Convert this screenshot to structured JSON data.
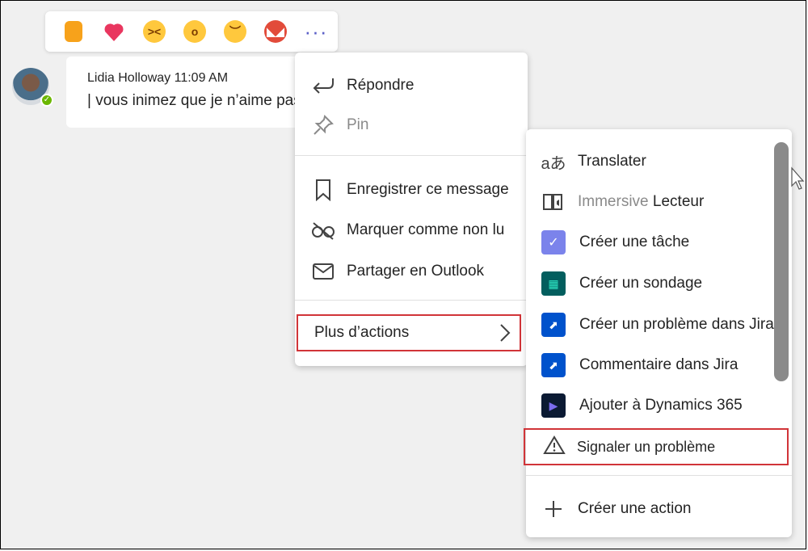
{
  "reactions": [
    {
      "name": "like",
      "color": "#f7a21b",
      "glyph": "👍"
    },
    {
      "name": "heart",
      "color": "#e9365f",
      "glyph": "❤"
    },
    {
      "name": "laugh",
      "color": "#ffc83d",
      "glyph": "😆"
    },
    {
      "name": "surprised",
      "color": "#ffc83d",
      "glyph": "😮"
    },
    {
      "name": "sad",
      "color": "#ffc83d",
      "glyph": "🙁"
    },
    {
      "name": "angry",
      "color": "#e24b3a",
      "glyph": "😡"
    }
  ],
  "message": {
    "author": "Lidia Holloway",
    "time": "11:09 AM",
    "text": "| vous inimez que je n’aime pas )"
  },
  "menu": {
    "reply": "Répondre",
    "pin": "Pin",
    "save": "Enregistrer ce message",
    "mark_unread": "Marquer comme non lu",
    "share_outlook": "Partager en Outlook",
    "more_actions": "Plus d’actions"
  },
  "submenu": {
    "translate": "Translater",
    "immersive_a": "Immersive",
    "immersive_b": "Lecteur",
    "create_task": "Créer une tâche",
    "create_poll": "Créer un sondage",
    "create_jira_issue": "Créer un problème dans Jira",
    "jira_comment": "Commentaire dans Jira",
    "add_dynamics": "Ajouter à Dynamics 365",
    "report_problem": "Signaler un problème",
    "create_action": "Créer une action"
  },
  "colors": {
    "accent": "#5b5fc7",
    "highlight": "#d13438",
    "jira": "#0052cc",
    "presence": "#6bb700"
  }
}
